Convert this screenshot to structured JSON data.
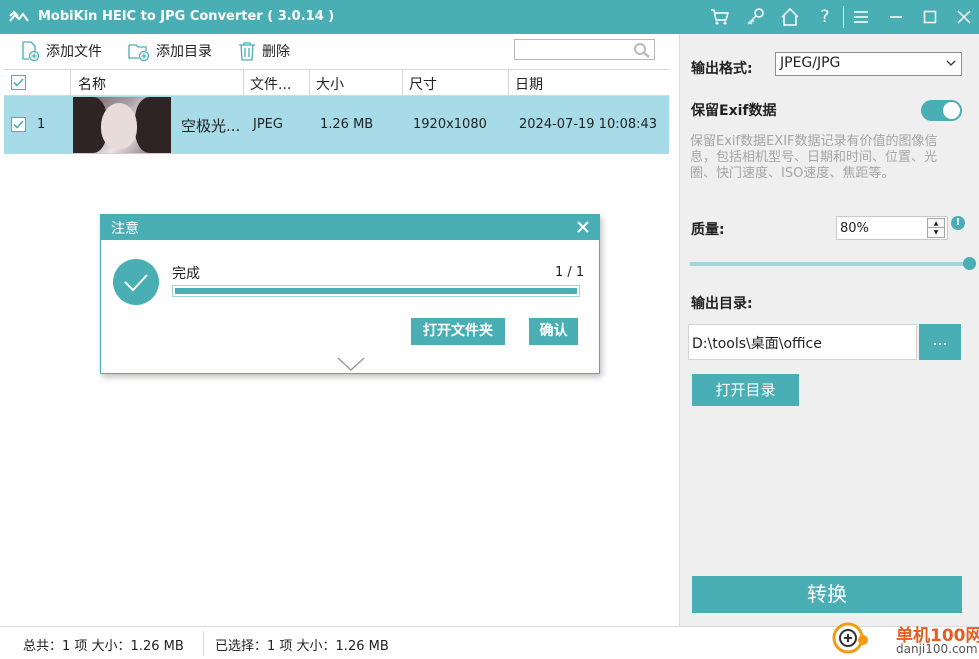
{
  "app": {
    "title": "MobiKin HEIC to JPG Converter   ( 3.0.14 )",
    "accent": "#4aaeb5",
    "titlebar_icons": [
      "cart-icon",
      "key-icon",
      "home-icon",
      "help-icon",
      "menu-icon",
      "minimize-icon",
      "maximize-icon",
      "close-icon"
    ]
  },
  "toolbar": {
    "add_file": "添加文件",
    "add_folder": "添加目录",
    "delete": "删除",
    "search_placeholder": ""
  },
  "table": {
    "columns": [
      "名称",
      "文件...",
      "大小",
      "尺寸",
      "日期"
    ],
    "rows": [
      {
        "index": "1",
        "name": "空极光...",
        "type": "JPEG",
        "size": "1.26 MB",
        "dimensions": "1920x1080",
        "date": "2024-07-19 10:08:43",
        "checked": true,
        "selected": true
      }
    ]
  },
  "settings": {
    "format_label": "输出格式:",
    "format_value": "JPEG/JPG",
    "exif_label": "保留Exif数据",
    "exif_enabled": true,
    "exif_desc": "保留Exif数据EXIF数据记录有价值的图像信息，包括相机型号、日期和时间、位置、光圈、快门速度、ISO速度、焦距等。",
    "quality_label": "质量:",
    "quality_value": "80%",
    "output_dir_label": "输出目录:",
    "output_dir_value": "D:\\tools\\桌面\\office",
    "browse": "...",
    "open_dir": "打开目录",
    "convert": "转换"
  },
  "status": {
    "total": "总共：1 项 大小：1.26 MB",
    "selected": "已选择：1 项 大小：1.26 MB"
  },
  "dialog": {
    "title": "注意",
    "message": "完成",
    "counter": "1 / 1",
    "progress": 1.0,
    "open_folder": "打开文件夹",
    "confirm": "确认"
  },
  "watermark": {
    "site_cn": "单机100网",
    "site_url": "danji100.com"
  }
}
